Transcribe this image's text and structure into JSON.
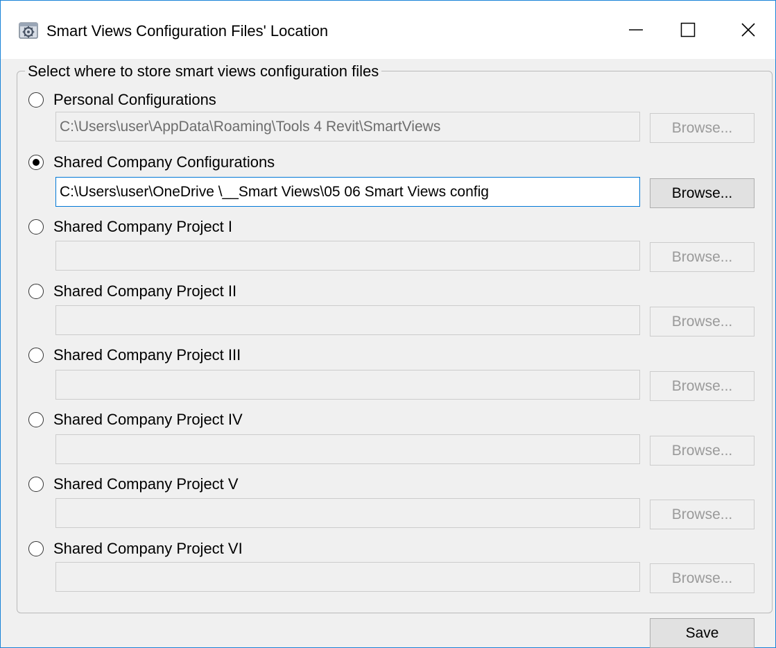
{
  "window": {
    "title": "Smart Views Configuration Files' Location",
    "icon": "gear-icon",
    "controls": [
      "minimize-icon",
      "maximize-icon",
      "close-icon"
    ]
  },
  "group": {
    "legend": "Select where to store smart views configuration files"
  },
  "options": [
    {
      "label": "Personal Configurations",
      "checked": false,
      "path": "C:\\Users\\user\\AppData\\Roaming\\Tools 4 Revit\\SmartViews",
      "browse_label": "Browse...",
      "enabled": false
    },
    {
      "label": "Shared Company Configurations",
      "checked": true,
      "path": "C:\\Users\\user\\OneDrive \\__Smart Views\\05 06 Smart Views config",
      "browse_label": "Browse...",
      "enabled": true
    },
    {
      "label": "Shared Company Project I",
      "checked": false,
      "path": "",
      "browse_label": "Browse...",
      "enabled": false
    },
    {
      "label": "Shared Company Project II",
      "checked": false,
      "path": "",
      "browse_label": "Browse...",
      "enabled": false
    },
    {
      "label": "Shared Company Project III",
      "checked": false,
      "path": "",
      "browse_label": "Browse...",
      "enabled": false
    },
    {
      "label": "Shared Company Project IV",
      "checked": false,
      "path": "",
      "browse_label": "Browse...",
      "enabled": false
    },
    {
      "label": "Shared Company Project V",
      "checked": false,
      "path": "",
      "browse_label": "Browse...",
      "enabled": false
    },
    {
      "label": "Shared Company Project VI",
      "checked": false,
      "path": "",
      "browse_label": "Browse...",
      "enabled": false
    }
  ],
  "footer": {
    "save_label": "Save"
  },
  "colors": {
    "window_border": "#1883d7",
    "focus_border": "#0078d7",
    "background": "#f0f0f0"
  }
}
